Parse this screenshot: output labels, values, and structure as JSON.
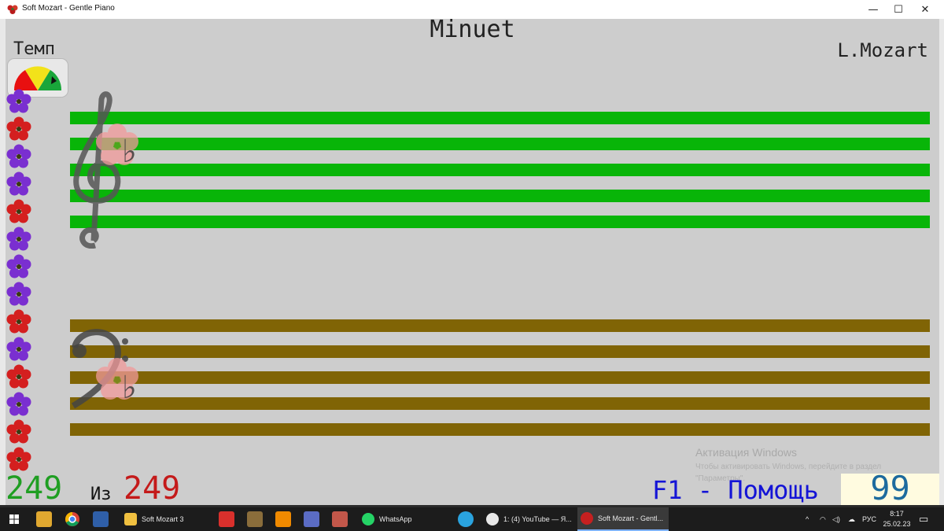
{
  "window": {
    "title": "Soft Mozart - Gentle Piano",
    "minimize": "—",
    "maximize": "☐",
    "close": "✕"
  },
  "piece": {
    "title": "Minuet",
    "composer": "L.Mozart"
  },
  "tempo": {
    "label": "Темп"
  },
  "staff": {
    "treble_color": "#08b508",
    "bass_color": "#806405",
    "key_signature": "♭"
  },
  "progress": {
    "current": "249",
    "separator": "Из",
    "total": "249"
  },
  "help": {
    "label": "F1 - Помощь"
  },
  "score": {
    "value": "99"
  },
  "activation": {
    "title": "Активация Windows",
    "text": "Чтобы активировать Windows, перейдите в раздел \"Параметры\"."
  },
  "taskbar": {
    "apps": [
      {
        "label": "Soft Mozart 3"
      },
      {
        "label": "WhatsApp"
      },
      {
        "label": "1: (4) YouTube — Я..."
      },
      {
        "label": "Soft Mozart - Gentl..."
      }
    ],
    "language": "РУС",
    "time": "8:17",
    "date": "25.02.23"
  }
}
